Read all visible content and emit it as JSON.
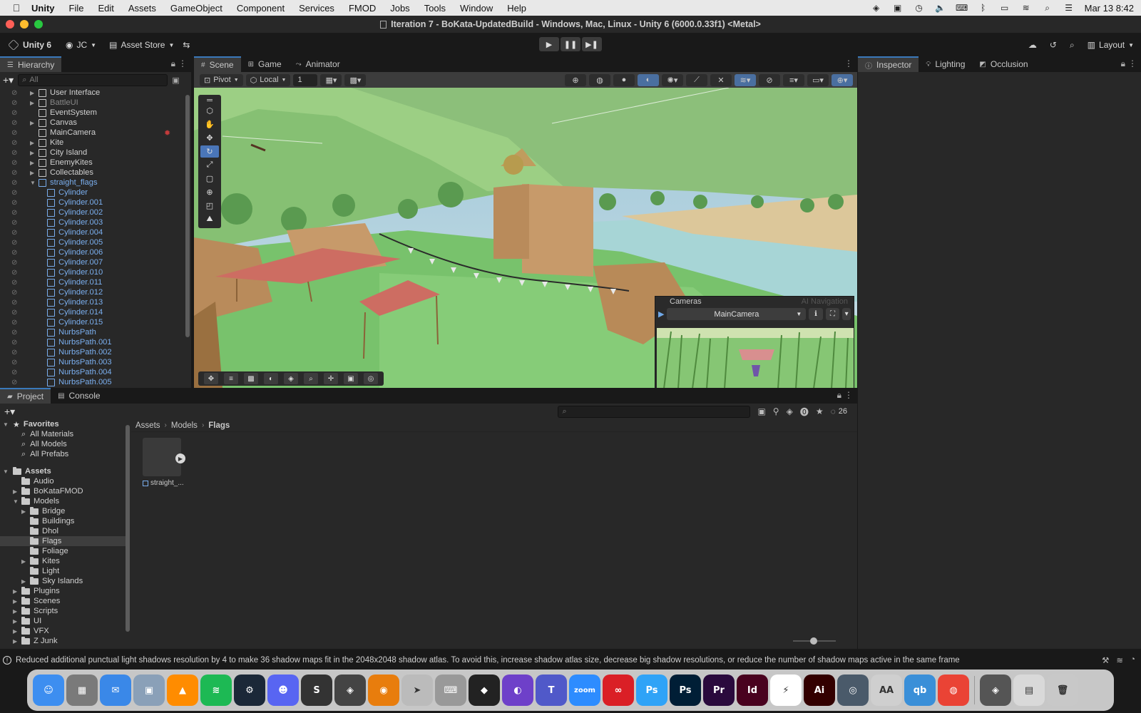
{
  "menubar": {
    "items": [
      "Unity",
      "File",
      "Edit",
      "Assets",
      "GameObject",
      "Component",
      "Services",
      "FMOD",
      "Jobs",
      "Tools",
      "Window",
      "Help"
    ],
    "clock": "Mar 13  8:42"
  },
  "window": {
    "title": "Iteration 7 - BoKata-UpdatedBuild - Windows, Mac, Linux - Unity 6 (6000.0.33f1) <Metal>"
  },
  "toolbar": {
    "account_label": "Unity 6",
    "user_label": "JC",
    "asset_store_label": "Asset Store",
    "layout_label": "Layout"
  },
  "hierarchy": {
    "tab_label": "Hierarchy",
    "search_placeholder": "All",
    "rows": [
      {
        "label": "User Interface",
        "indent": 1,
        "arrow": true,
        "style": "normal"
      },
      {
        "label": "BattleUI",
        "indent": 1,
        "arrow": true,
        "style": "dim"
      },
      {
        "label": "EventSystem",
        "indent": 1,
        "arrow": false,
        "style": "normal"
      },
      {
        "label": "Canvas",
        "indent": 1,
        "arrow": true,
        "style": "normal"
      },
      {
        "label": "MainCamera",
        "indent": 1,
        "arrow": false,
        "style": "normal"
      },
      {
        "label": "Kite",
        "indent": 1,
        "arrow": true,
        "style": "normal"
      },
      {
        "label": "City Island",
        "indent": 1,
        "arrow": true,
        "style": "normal"
      },
      {
        "label": "EnemyKites",
        "indent": 1,
        "arrow": true,
        "style": "normal"
      },
      {
        "label": "Collectables",
        "indent": 1,
        "arrow": true,
        "style": "normal"
      },
      {
        "label": "straight_flags",
        "indent": 1,
        "arrow": "open",
        "style": "blue"
      },
      {
        "label": "Cylinder",
        "indent": 2,
        "arrow": false,
        "style": "blue"
      },
      {
        "label": "Cylinder.001",
        "indent": 2,
        "arrow": false,
        "style": "blue"
      },
      {
        "label": "Cylinder.002",
        "indent": 2,
        "arrow": false,
        "style": "blue"
      },
      {
        "label": "Cylinder.003",
        "indent": 2,
        "arrow": false,
        "style": "blue"
      },
      {
        "label": "Cylinder.004",
        "indent": 2,
        "arrow": false,
        "style": "blue"
      },
      {
        "label": "Cylinder.005",
        "indent": 2,
        "arrow": false,
        "style": "blue"
      },
      {
        "label": "Cylinder.006",
        "indent": 2,
        "arrow": false,
        "style": "blue"
      },
      {
        "label": "Cylinder.007",
        "indent": 2,
        "arrow": false,
        "style": "blue"
      },
      {
        "label": "Cylinder.010",
        "indent": 2,
        "arrow": false,
        "style": "blue"
      },
      {
        "label": "Cylinder.011",
        "indent": 2,
        "arrow": false,
        "style": "blue"
      },
      {
        "label": "Cylinder.012",
        "indent": 2,
        "arrow": false,
        "style": "blue"
      },
      {
        "label": "Cylinder.013",
        "indent": 2,
        "arrow": false,
        "style": "blue"
      },
      {
        "label": "Cylinder.014",
        "indent": 2,
        "arrow": false,
        "style": "blue"
      },
      {
        "label": "Cylinder.015",
        "indent": 2,
        "arrow": false,
        "style": "blue"
      },
      {
        "label": "NurbsPath",
        "indent": 2,
        "arrow": false,
        "style": "blue"
      },
      {
        "label": "NurbsPath.001",
        "indent": 2,
        "arrow": false,
        "style": "blue"
      },
      {
        "label": "NurbsPath.002",
        "indent": 2,
        "arrow": false,
        "style": "blue"
      },
      {
        "label": "NurbsPath.003",
        "indent": 2,
        "arrow": false,
        "style": "blue"
      },
      {
        "label": "NurbsPath.004",
        "indent": 2,
        "arrow": false,
        "style": "blue"
      },
      {
        "label": "NurbsPath.005",
        "indent": 2,
        "arrow": false,
        "style": "blue"
      }
    ]
  },
  "scene": {
    "tabs": [
      {
        "label": "Scene",
        "icon": "grid-icon",
        "active": true
      },
      {
        "label": "Game",
        "icon": "gamepad-icon",
        "active": false
      },
      {
        "label": "Animator",
        "icon": "animator-icon",
        "active": false
      }
    ],
    "pivot_label": "Pivot",
    "local_label": "Local",
    "grid_value": "1",
    "cameras": {
      "title": "Cameras",
      "ghost_label": "AI Navigation",
      "selected_camera": "MainCamera"
    }
  },
  "inspector": {
    "tabs": [
      {
        "label": "Inspector",
        "icon": "info-icon",
        "active": true
      },
      {
        "label": "Lighting",
        "icon": "bulb-icon",
        "active": false
      },
      {
        "label": "Occlusion",
        "icon": "occlusion-icon",
        "active": false
      }
    ]
  },
  "project": {
    "tabs": [
      {
        "label": "Project",
        "icon": "folder-icon",
        "active": true
      },
      {
        "label": "Console",
        "icon": "console-icon",
        "active": false
      }
    ],
    "hidden_count": "26",
    "favorites_label": "Favorites",
    "favorites": [
      "All Materials",
      "All Models",
      "All Prefabs"
    ],
    "assets_label": "Assets",
    "tree": [
      {
        "label": "Audio",
        "indent": 1,
        "arrow": false,
        "selected": false
      },
      {
        "label": "BoKataFMOD",
        "indent": 1,
        "arrow": true,
        "selected": false
      },
      {
        "label": "Models",
        "indent": 1,
        "arrow": "open",
        "selected": false
      },
      {
        "label": "Bridge",
        "indent": 2,
        "arrow": true,
        "selected": false
      },
      {
        "label": "Buildings",
        "indent": 2,
        "arrow": false,
        "selected": false
      },
      {
        "label": "Dhol",
        "indent": 2,
        "arrow": false,
        "selected": false
      },
      {
        "label": "Flags",
        "indent": 2,
        "arrow": false,
        "selected": true
      },
      {
        "label": "Foliage",
        "indent": 2,
        "arrow": false,
        "selected": false
      },
      {
        "label": "Kites",
        "indent": 2,
        "arrow": true,
        "selected": false
      },
      {
        "label": "Light",
        "indent": 2,
        "arrow": false,
        "selected": false
      },
      {
        "label": "Sky Islands",
        "indent": 2,
        "arrow": true,
        "selected": false
      },
      {
        "label": "Plugins",
        "indent": 1,
        "arrow": true,
        "selected": false
      },
      {
        "label": "Scenes",
        "indent": 1,
        "arrow": true,
        "selected": false
      },
      {
        "label": "Scripts",
        "indent": 1,
        "arrow": true,
        "selected": false
      },
      {
        "label": "UI",
        "indent": 1,
        "arrow": true,
        "selected": false
      },
      {
        "label": "VFX",
        "indent": 1,
        "arrow": true,
        "selected": false
      },
      {
        "label": "Z Junk",
        "indent": 1,
        "arrow": true,
        "selected": false
      }
    ],
    "breadcrumb": [
      "Assets",
      "Models",
      "Flags"
    ],
    "asset_label": "straight_..."
  },
  "status": {
    "message": "Reduced additional punctual light shadows resolution by 4 to make 36 shadow maps fit in the 2048x2048 shadow atlas. To avoid this, increase shadow atlas size, decrease big shadow resolutions, or reduce the number of shadow maps active in the same frame"
  },
  "dock": [
    {
      "name": "finder",
      "color": "#3d8ef0",
      "glyph": "☺"
    },
    {
      "name": "launchpad",
      "color": "#7a7a7a",
      "glyph": "▦"
    },
    {
      "name": "mail",
      "color": "#3a88e8",
      "glyph": "✉"
    },
    {
      "name": "preview",
      "color": "#8aa0b8",
      "glyph": "▣"
    },
    {
      "name": "vlc",
      "color": "#ff8c00",
      "glyph": "▲"
    },
    {
      "name": "spotify",
      "color": "#1db954",
      "glyph": "≋"
    },
    {
      "name": "steam",
      "color": "#1b2838",
      "glyph": "⚙"
    },
    {
      "name": "discord",
      "color": "#5865f2",
      "glyph": "☻"
    },
    {
      "name": "sublime",
      "color": "#333333",
      "glyph": "S"
    },
    {
      "name": "unity",
      "color": "#444444",
      "glyph": "◈"
    },
    {
      "name": "blender",
      "color": "#e87d0d",
      "glyph": "◉"
    },
    {
      "name": "cursor-app",
      "color": "#bbbbbb",
      "glyph": "➤"
    },
    {
      "name": "keyboard-app",
      "color": "#999999",
      "glyph": "⌨"
    },
    {
      "name": "unity-hub",
      "color": "#222222",
      "glyph": "◆"
    },
    {
      "name": "github-desktop",
      "color": "#6e40c9",
      "glyph": "◐"
    },
    {
      "name": "teams",
      "color": "#5059c9",
      "glyph": "T"
    },
    {
      "name": "zoom",
      "color": "#2d8cff",
      "glyph": "zoom"
    },
    {
      "name": "creative-cloud",
      "color": "#da1f26",
      "glyph": "∞"
    },
    {
      "name": "photoshop-beta",
      "color": "#2fa3f7",
      "glyph": "Ps"
    },
    {
      "name": "photoshop",
      "color": "#001e36",
      "glyph": "Ps"
    },
    {
      "name": "premiere",
      "color": "#2a0a3d",
      "glyph": "Pr"
    },
    {
      "name": "indesign",
      "color": "#49021f",
      "glyph": "Id"
    },
    {
      "name": "acrobat",
      "color": "#ffffff",
      "glyph": "⚡"
    },
    {
      "name": "illustrator",
      "color": "#330000",
      "glyph": "Ai"
    },
    {
      "name": "quicktime",
      "color": "#4a5a6a",
      "glyph": "◎"
    },
    {
      "name": "font-book",
      "color": "#cfcfcf",
      "glyph": "AA"
    },
    {
      "name": "qbittorrent",
      "color": "#3a8fd8",
      "glyph": "qb"
    },
    {
      "name": "chrome",
      "color": "#ea4335",
      "glyph": "◍"
    },
    {
      "name": "unity-2",
      "color": "#555555",
      "glyph": "◈"
    },
    {
      "name": "downloads",
      "color": "#d9d9d9",
      "glyph": "▤"
    },
    {
      "name": "trash",
      "color": "#c8c8c8",
      "glyph": "🗑"
    }
  ]
}
